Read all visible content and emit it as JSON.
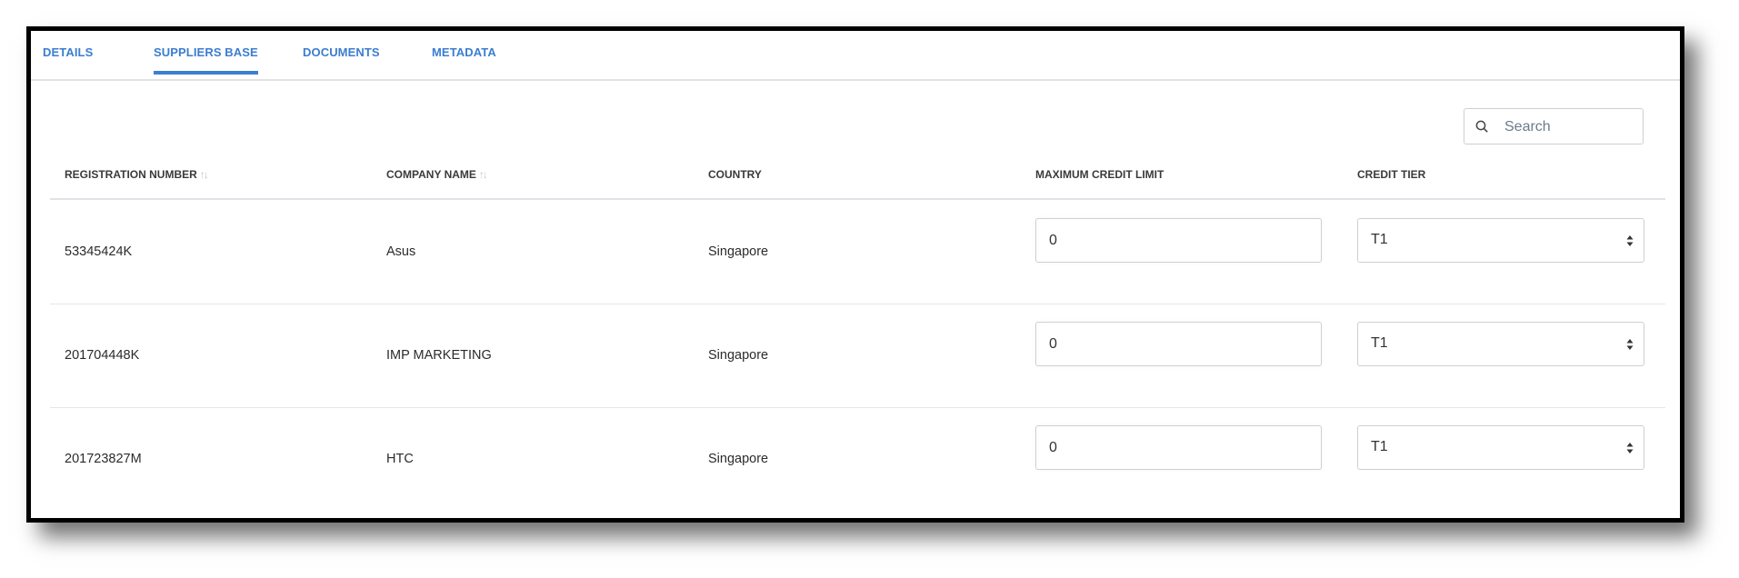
{
  "tabs": [
    {
      "label": "DETAILS",
      "active": false
    },
    {
      "label": "SUPPLIERS BASE",
      "active": true
    },
    {
      "label": "DOCUMENTS",
      "active": false
    },
    {
      "label": "METADATA",
      "active": false
    }
  ],
  "search": {
    "placeholder": "Search",
    "value": "",
    "icon": "search-icon"
  },
  "table": {
    "columns": [
      {
        "label": "REGISTRATION NUMBER",
        "sortable": true
      },
      {
        "label": "COMPANY NAME",
        "sortable": true
      },
      {
        "label": "COUNTRY",
        "sortable": false
      },
      {
        "label": "MAXIMUM CREDIT LIMIT",
        "sortable": false
      },
      {
        "label": "CREDIT TIER",
        "sortable": false
      }
    ],
    "sort_icon": "↑↓",
    "rows": [
      {
        "registration_number": "53345424K",
        "company_name": "Asus",
        "country": "Singapore",
        "max_credit_limit": "0",
        "credit_tier": "T1"
      },
      {
        "registration_number": "201704448K",
        "company_name": "IMP MARKETING",
        "country": "Singapore",
        "max_credit_limit": "0",
        "credit_tier": "T1"
      },
      {
        "registration_number": "201723827M",
        "company_name": "HTC",
        "country": "Singapore",
        "max_credit_limit": "0",
        "credit_tier": "T1"
      }
    ]
  },
  "colors": {
    "accent": "#3d7fcf",
    "header_text": "#3a3a3a",
    "body_text": "#2b2b2b"
  }
}
